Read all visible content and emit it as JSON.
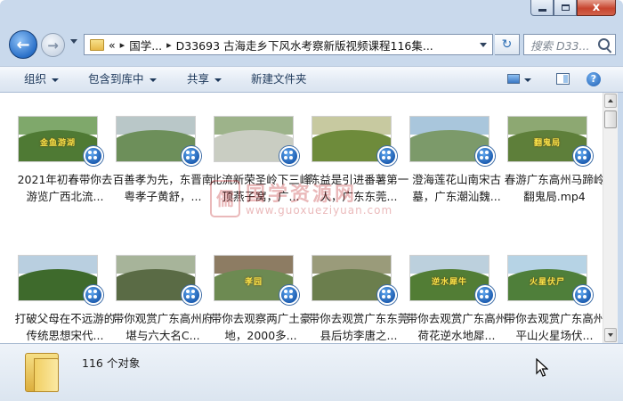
{
  "window": {
    "minimize_label": "",
    "close_label": "x"
  },
  "nav": {
    "address_prefix": "«",
    "breadcrumb": [
      "国学...",
      "D33693 古海走乡下风水考察新版视频课程116集..."
    ],
    "search_placeholder": "搜索 D33...",
    "refresh_symbol": "↻"
  },
  "toolbar": {
    "organize": "组织",
    "include_in_library": "包含到库中",
    "share": "共享",
    "new_folder": "新建文件夹",
    "help": "?"
  },
  "files": [
    {
      "name": "2021年初春带你去游览广西北流...",
      "thumb": {
        "sky": "#7fa86b",
        "hill": "#4f7a34",
        "cap": "金鱼游湖"
      }
    },
    {
      "name": "百善孝为先，东晋南粤孝子黄舒，...",
      "thumb": {
        "sky": "#b9c7c8",
        "hill": "#6d8f5a",
        "cap": ""
      }
    },
    {
      "name": "北流新荣圣岭下三峰顶燕子窝，广...",
      "thumb": {
        "sky": "#9db38a",
        "hill": "#c9cdc2",
        "cap": ""
      }
    },
    {
      "name": "陈益是引进番薯第一人，广东东莞...",
      "thumb": {
        "sky": "#c7c9a0",
        "hill": "#6e8b3b",
        "cap": ""
      }
    },
    {
      "name": "澄海莲花山南宋古墓，广东潮汕魏...",
      "thumb": {
        "sky": "#a9c6dc",
        "hill": "#7c9a6a",
        "cap": ""
      }
    },
    {
      "name": "春游广东高州马蹄岭翻鬼局.mp4",
      "thumb": {
        "sky": "#8da872",
        "hill": "#5e7f3a",
        "cap": "翻鬼局"
      }
    },
    {
      "name": "打破父母在不远游的传统思想宋代...",
      "thumb": {
        "sky": "#b9cfe0",
        "hill": "#3e6a2c",
        "cap": ""
      }
    },
    {
      "name": "带你观赏广东高州府堪与六大名C...",
      "thumb": {
        "sky": "#a7b49a",
        "hill": "#5a6b45",
        "cap": ""
      }
    },
    {
      "name": "带你去观察两广土豪地，2000多...",
      "thumb": {
        "sky": "#8d7c63",
        "hill": "#6d8a52",
        "cap": "孝园"
      }
    },
    {
      "name": "带你去观赏广东东莞县后坊李唐之...",
      "thumb": {
        "sky": "#9a9b7a",
        "hill": "#6b7e4d",
        "cap": ""
      }
    },
    {
      "name": "带你去观赏广东高州荷花逆水地犀...",
      "thumb": {
        "sky": "#bcd0dd",
        "hill": "#527d35",
        "cap": "逆水犀牛"
      }
    },
    {
      "name": "带你去观赏广东高州平山火星场伏...",
      "thumb": {
        "sky": "#b6d3e5",
        "hill": "#4f7f3a",
        "cap": "火星伏尸"
      }
    }
  ],
  "watermark": {
    "logo": "儒",
    "text": "国学资源网",
    "url": "www.guoxueziyuan.com"
  },
  "status": {
    "count_text": "116 个对象"
  }
}
